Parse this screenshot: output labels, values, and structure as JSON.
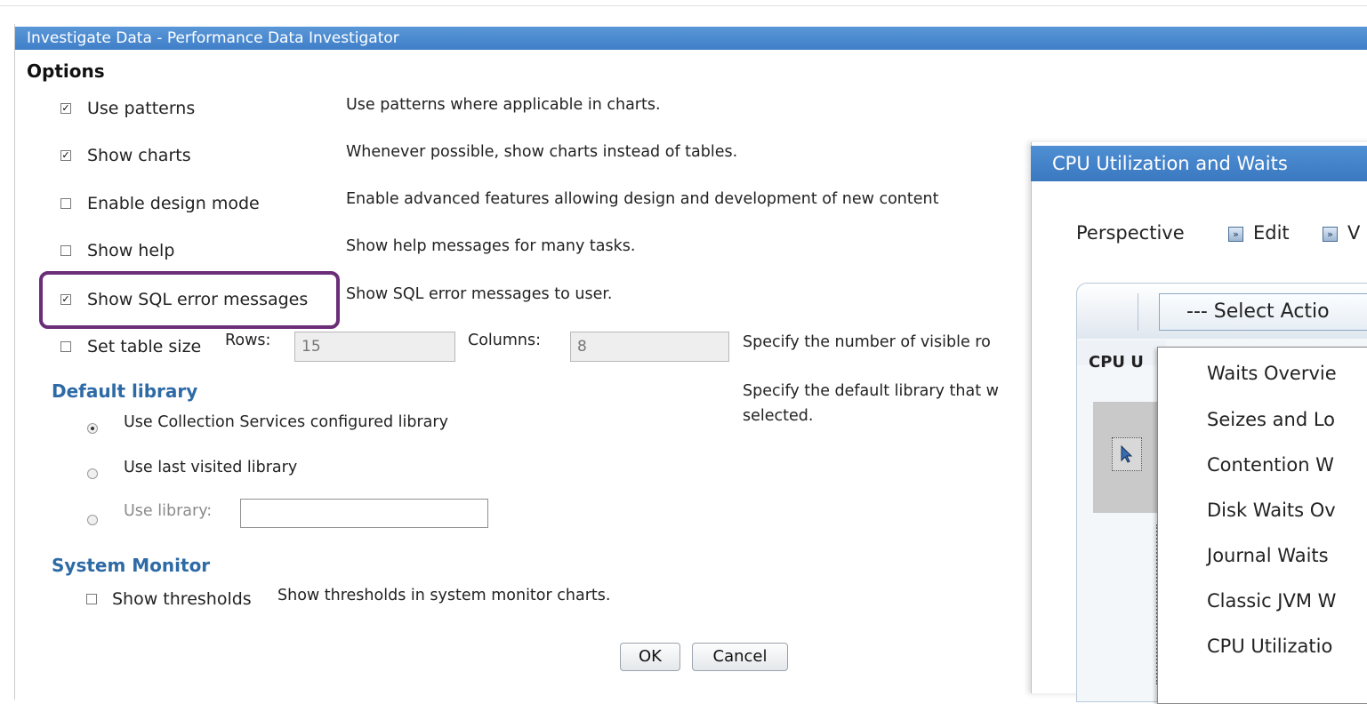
{
  "window": {
    "title": "Investigate Data - Performance Data Investigator"
  },
  "options": {
    "heading": "Options",
    "items": [
      {
        "label": "Use patterns",
        "checked": true,
        "description": "Use patterns where applicable in charts."
      },
      {
        "label": "Show charts",
        "checked": true,
        "description": "Whenever possible, show charts instead of tables."
      },
      {
        "label": "Enable design mode",
        "checked": false,
        "description": "Enable advanced features allowing design and development of new content"
      },
      {
        "label": "Show help",
        "checked": false,
        "description": "Show help messages for many tasks."
      },
      {
        "label": "Show SQL error messages",
        "checked": true,
        "description": "Show SQL error messages to user."
      }
    ],
    "table_size": {
      "label": "Set table size",
      "checked": false,
      "rows_label": "Rows:",
      "rows_value": "15",
      "columns_label": "Columns:",
      "columns_value": "8",
      "description": "Specify the number of visible ro"
    }
  },
  "default_library": {
    "heading": "Default library",
    "description_line1": "Specify the default library that w",
    "description_line2": "selected.",
    "options": [
      {
        "label": "Use Collection Services configured library",
        "selected": true
      },
      {
        "label": "Use last visited library",
        "selected": false
      },
      {
        "label": "Use library:",
        "selected": false,
        "value": ""
      }
    ]
  },
  "system_monitor": {
    "heading": "System Monitor",
    "show_thresholds_label": "Show thresholds",
    "show_thresholds_checked": false,
    "description": "Show thresholds in system monitor charts."
  },
  "buttons": {
    "ok": "OK",
    "cancel": "Cancel"
  },
  "second_window": {
    "title": "CPU Utilization and Waits",
    "toolbar": {
      "perspective": "Perspective",
      "edit": "Edit",
      "view_partial": "V"
    },
    "select_action": "--- Select Actio",
    "panel_label": "CPU U",
    "menu_items": [
      "Waits Overvie",
      "Seizes and Lo",
      "Contention W",
      "Disk Waits Ov",
      "Journal Waits",
      "Classic JVM W",
      "CPU Utilizatio"
    ]
  },
  "colors": {
    "titlebar": "#3f7fc8",
    "highlight_border": "#6b2c78",
    "section_blue": "#2e6aa6"
  }
}
